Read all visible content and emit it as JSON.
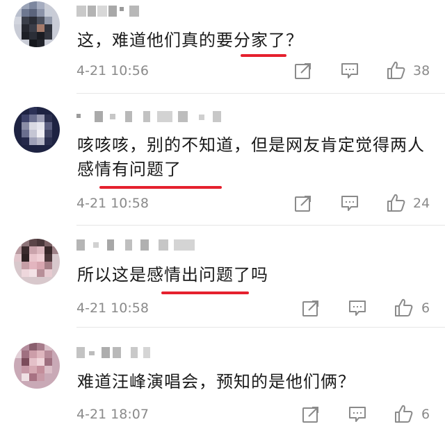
{
  "comments": [
    {
      "text": "这，难道他们真的要分家了？",
      "time": "4-21 10:56",
      "likes": "38",
      "icons": [
        "share-icon",
        "comment-icon",
        "like-icon"
      ]
    },
    {
      "text": "咳咳咳，别的不知道，但是网友肯定觉得两人感情有问题了",
      "time": "4-21 10:58",
      "likes": "24",
      "icons": [
        "share-icon",
        "comment-icon",
        "like-icon"
      ]
    },
    {
      "text": "所以这是感情出问题了吗",
      "time": "4-21 10:58",
      "likes": "6",
      "icons": [
        "share-icon",
        "comment-icon",
        "like-icon"
      ]
    },
    {
      "text": "难道汪峰演唱会，预知的是他们俩？",
      "time": "4-21 18:07",
      "likes": "6",
      "icons": [
        "share-icon",
        "comment-icon",
        "like-icon"
      ]
    }
  ],
  "colors": {
    "text": "#1a1a1a",
    "meta": "#8a8a8a",
    "underline": "#e5202e",
    "divider": "#e6e6e6"
  }
}
